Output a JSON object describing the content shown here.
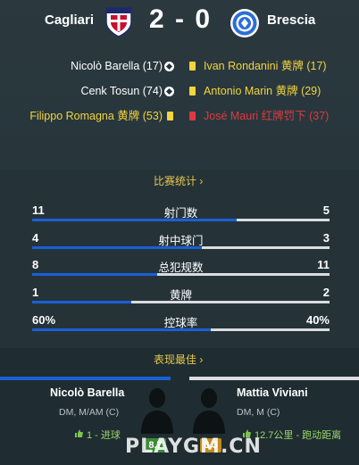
{
  "match": {
    "home_team": "Cagliari",
    "away_team": "Brescia",
    "score": "2 - 0"
  },
  "events": {
    "home": [
      {
        "text": "Nicolò Barella (17)",
        "icon": "goal-ball-icon"
      },
      {
        "text": "Cenk Tosun (74)",
        "icon": "goal-ball-icon"
      },
      {
        "text": "Filippo Romagna 黄牌 (53)",
        "icon": "yellow-card-icon",
        "color": "#f2d43c"
      }
    ],
    "away": [
      {
        "text": "Ivan Rondanini 黄牌 (17)",
        "icon": "yellow-card-icon",
        "color": "#f2d43c"
      },
      {
        "text": "Antonio Marin 黄牌 (29)",
        "icon": "yellow-card-icon",
        "color": "#f2d43c"
      },
      {
        "text": "José Mauri 红牌罚下 (37)",
        "icon": "red-card-icon",
        "color": "#e0383e"
      }
    ]
  },
  "stats_header": "比赛统计 ›",
  "stats": [
    {
      "label": "射门数",
      "home": "11",
      "away": "5",
      "home_share": 0.6875
    },
    {
      "label": "射中球门",
      "home": "4",
      "away": "3",
      "home_share": 0.5714
    },
    {
      "label": "总犯规数",
      "home": "8",
      "away": "11",
      "home_share": 0.4211
    },
    {
      "label": "黄牌",
      "home": "1",
      "away": "2",
      "home_share": 0.3333
    },
    {
      "label": "控球率",
      "home": "60%",
      "away": "40%",
      "home_share": 0.6
    }
  ],
  "best_header": "表现最佳 ›",
  "best_players": {
    "home": {
      "name": "Nicolò Barella",
      "position": "DM, M/AM (C)",
      "note": "1 - 进球",
      "rating": "8.7"
    },
    "away": {
      "name": "Mattia Viviani",
      "position": "DM, M (C)",
      "note": "12.7公里 - 跑动距离",
      "rating": "6.3"
    }
  },
  "watermark": "PLAYGM.CN",
  "colors": {
    "background": "#263238",
    "accent_blue": "#1a5fd6",
    "yellow_text": "#f2d43c",
    "red_text": "#e0383e",
    "green_note": "#9bd56a",
    "link_gold": "#e8c84a"
  }
}
